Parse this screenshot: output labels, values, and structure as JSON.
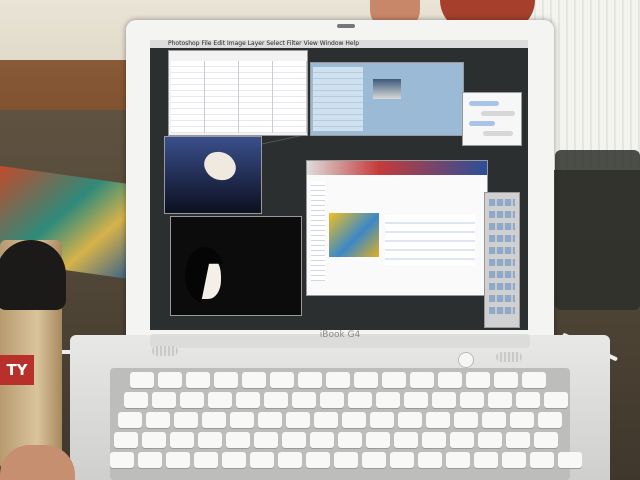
{
  "laptop": {
    "brand_label": "iBook G4"
  },
  "screen": {
    "menubar_items": [
      "Photoshop",
      "File",
      "Edit",
      "Image",
      "Layer",
      "Select",
      "Filter",
      "View",
      "Window",
      "Help"
    ]
  },
  "cup": {
    "band_text": "TY"
  },
  "colors": {
    "lid": "#f4f4f2",
    "desktop": "#2c2f30",
    "cup_band": "#b8302a",
    "pot": "#a63f2b"
  }
}
